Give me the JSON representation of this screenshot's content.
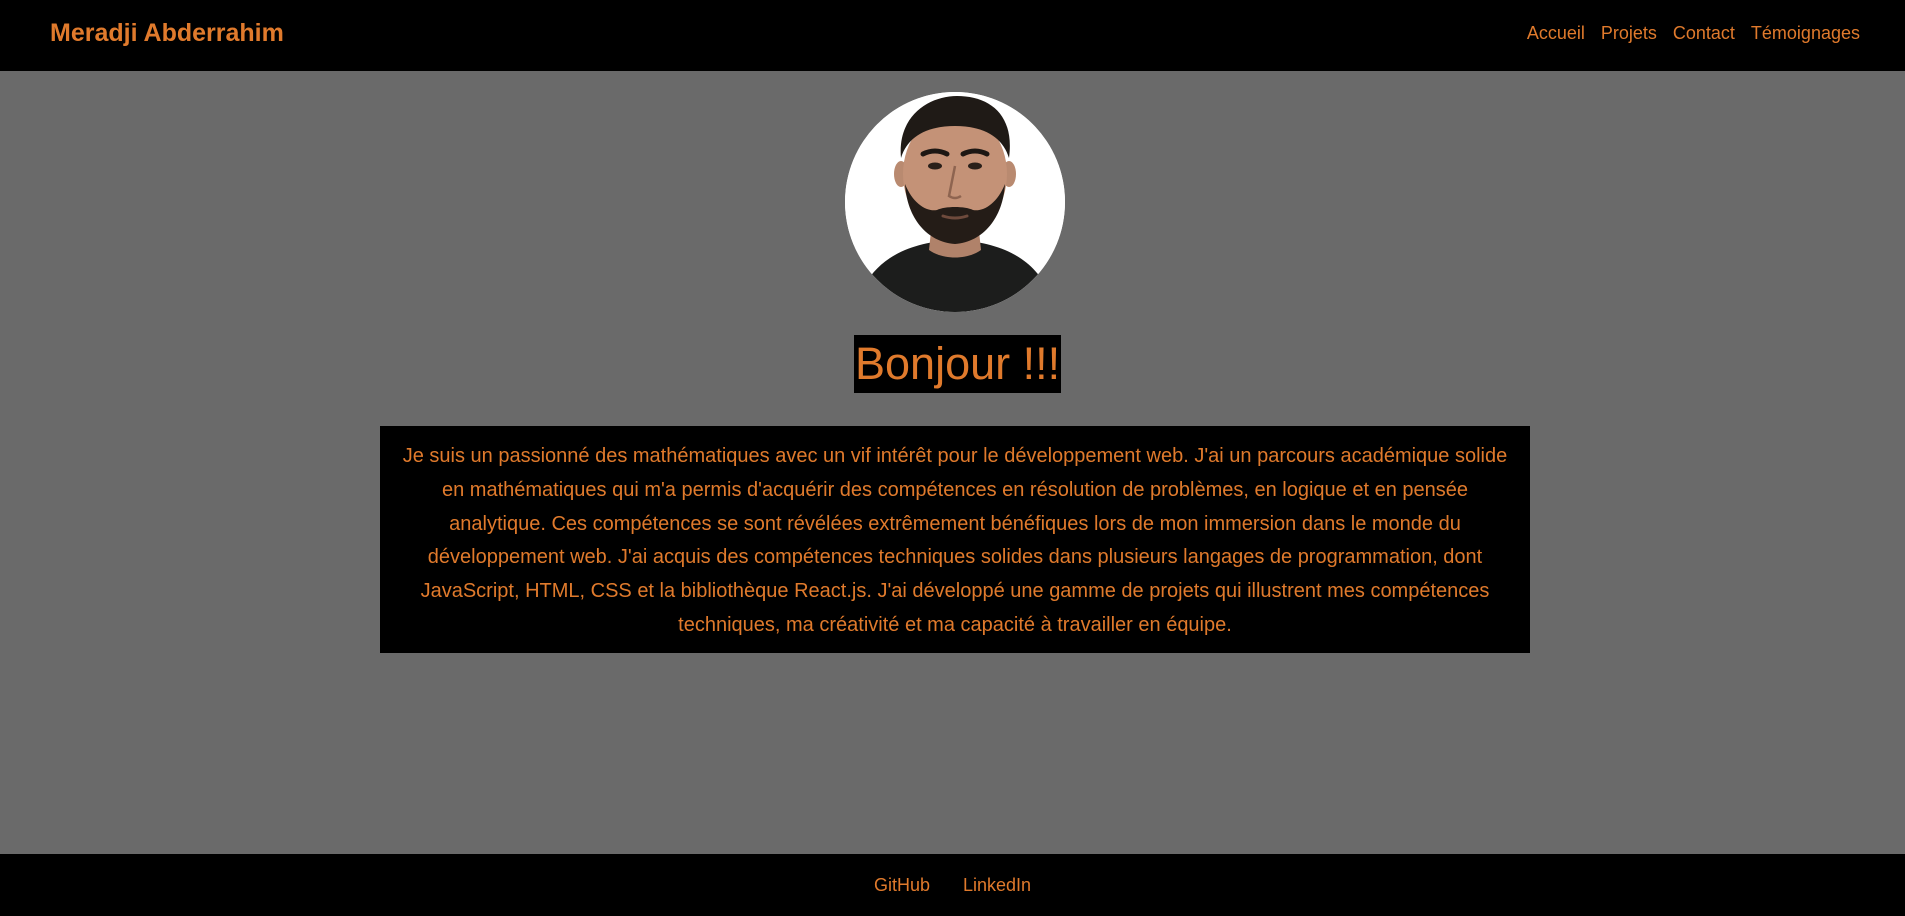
{
  "header": {
    "brand": "Meradji Abderrahim",
    "nav": [
      {
        "label": "Accueil"
      },
      {
        "label": "Projets"
      },
      {
        "label": "Contact"
      },
      {
        "label": "Témoignages"
      }
    ]
  },
  "hero": {
    "greeting": "Bonjour !!!",
    "bio": "Je suis un passionné des mathématiques avec un vif intérêt pour le développement web. J'ai un parcours académique solide en mathématiques qui m'a permis d'acquérir des compétences en résolution de problèmes, en logique et en pensée analytique. Ces compétences se sont révélées extrêmement bénéfiques lors de mon immersion dans le monde du développement web. J'ai acquis des compétences techniques solides dans plusieurs langages de programmation, dont JavaScript, HTML, CSS et la bibliothèque React.js. J'ai développé une gamme de projets qui illustrent mes compétences techniques, ma créativité et ma capacité à travailler en équipe."
  },
  "footer": {
    "links": [
      {
        "label": "GitHub"
      },
      {
        "label": "LinkedIn"
      }
    ]
  },
  "colors": {
    "accent": "#e07a2c",
    "background": "#6a6a6a",
    "bars": "#000000"
  }
}
